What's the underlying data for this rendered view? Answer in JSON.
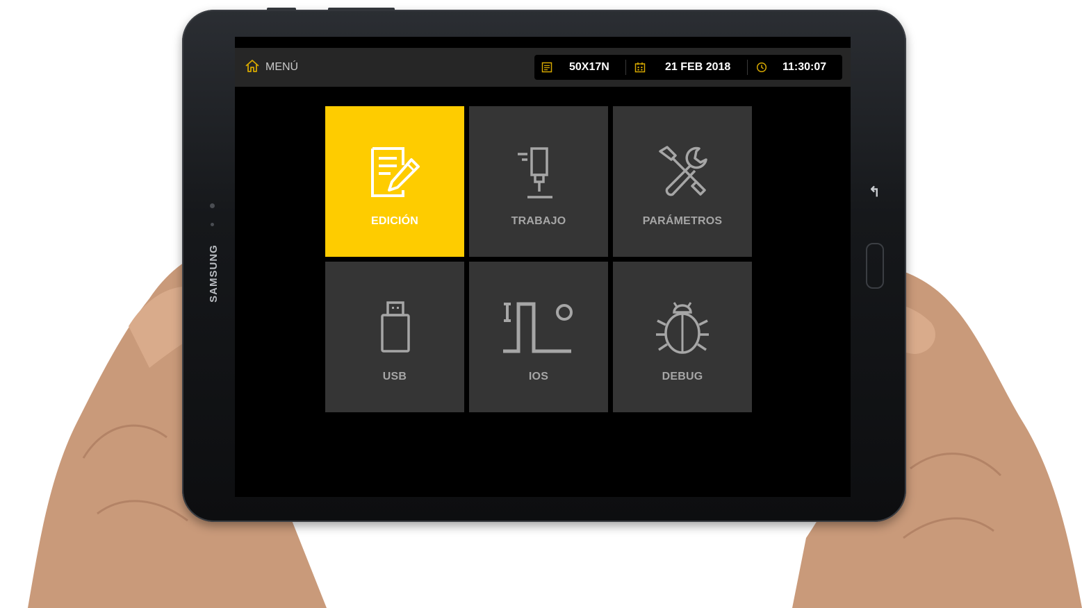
{
  "device": {
    "brand": "SAMSUNG"
  },
  "header": {
    "menu_label": "MENÚ",
    "menu_icon": "home-icon",
    "program": "50X17N",
    "program_icon": "program-icon",
    "date": "21 FEB 2018",
    "date_icon": "calendar-icon",
    "time": "11:30:07",
    "time_icon": "clock-icon"
  },
  "tiles": [
    {
      "label": "EDICIÓN",
      "icon": "edit-icon",
      "active": true
    },
    {
      "label": "TRABAJO",
      "icon": "spindle-icon",
      "active": false
    },
    {
      "label": "PARÁMETROS",
      "icon": "tools-icon",
      "active": false
    },
    {
      "label": "USB",
      "icon": "usb-icon",
      "active": false
    },
    {
      "label": "IOS",
      "icon": "io-signal-icon",
      "active": false
    },
    {
      "label": "DEBUG",
      "icon": "bug-icon",
      "active": false
    }
  ],
  "colors": {
    "accent": "#fecc00",
    "tile": "#353535",
    "tile_label": "#a6a6a6",
    "topbar": "#262626",
    "icon_accent": "#d6a800"
  }
}
